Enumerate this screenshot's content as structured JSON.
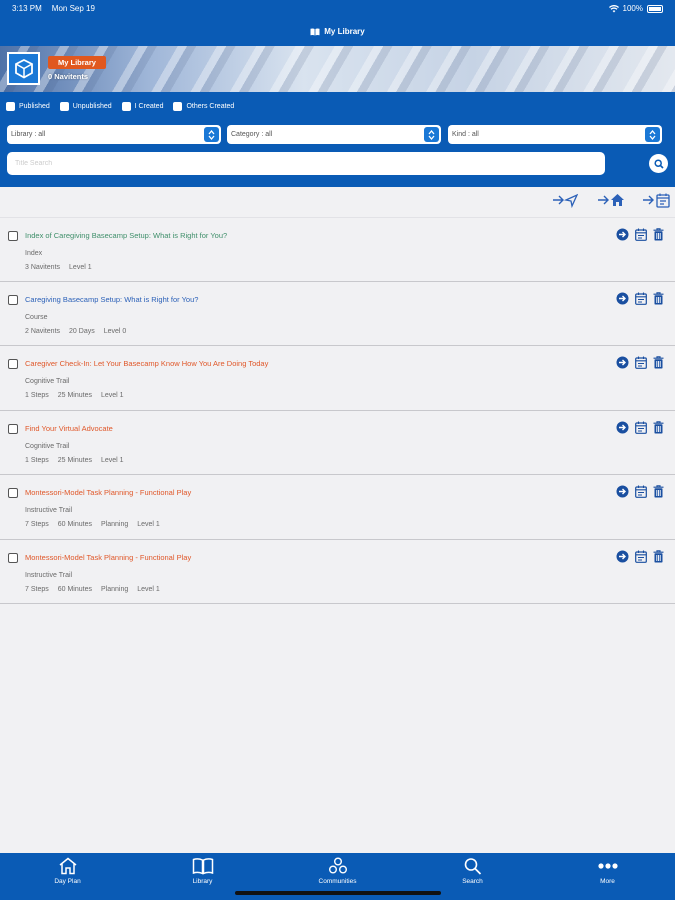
{
  "status": {
    "time": "3:13 PM",
    "date": "Mon Sep 19",
    "battery": "100%"
  },
  "navbar": {
    "title": "My Library",
    "icon": "book-icon"
  },
  "banner": {
    "badge": "My Library",
    "count": "0 Navitents"
  },
  "filters": {
    "checkboxes": [
      "Published",
      "Unpublished",
      "I Created",
      "Others Created"
    ],
    "library": "Library : all",
    "category": "Category : all",
    "kind": "Kind : all",
    "search_placeholder": "Title Search"
  },
  "top_actions": [
    "send-to-icon",
    "move-home-icon",
    "move-to-calendar-icon"
  ],
  "items": [
    {
      "title": "Index of Caregiving Basecamp Setup: What is Right for You?",
      "color": "green",
      "kind": "Index",
      "meta": [
        "3 Navitents",
        "Level 1"
      ]
    },
    {
      "title": "Caregiving Basecamp Setup: What is Right for You?",
      "color": "blue",
      "kind": "Course",
      "meta": [
        "2 Navitents",
        "20 Days",
        "Level 0"
      ]
    },
    {
      "title": "Caregiver Check-In: Let Your Basecamp Know How You Are Doing Today",
      "color": "orange",
      "kind": "Cognitive Trail",
      "meta": [
        "1 Steps",
        "25 Minutes",
        "Level 1"
      ]
    },
    {
      "title": "Find Your Virtual Advocate",
      "color": "orange",
      "kind": "Cognitive Trail",
      "meta": [
        "1 Steps",
        "25 Minutes",
        "Level 1"
      ]
    },
    {
      "title": "Montessori-Model Task Planning - Functional Play",
      "color": "orange",
      "kind": "Instructive Trail",
      "meta": [
        "7 Steps",
        "60 Minutes",
        "Planning",
        "Level 1"
      ]
    },
    {
      "title": "Montessori-Model Task Planning - Functional Play",
      "color": "orange",
      "kind": "Instructive Trail",
      "meta": [
        "7 Steps",
        "60 Minutes",
        "Planning",
        "Level 1"
      ]
    }
  ],
  "tabs": [
    {
      "label": "Day Plan",
      "icon": "home-icon"
    },
    {
      "label": "Library",
      "icon": "book-icon"
    },
    {
      "label": "Communities",
      "icon": "communities-icon"
    },
    {
      "label": "Search",
      "icon": "search-icon"
    },
    {
      "label": "More",
      "icon": "more-icon"
    }
  ],
  "colors": {
    "primary": "#0a5bb5",
    "accent": "#e0581f",
    "title_blue": "#2c61b8",
    "title_green": "#3f8f6a",
    "title_orange": "#e0582a"
  }
}
